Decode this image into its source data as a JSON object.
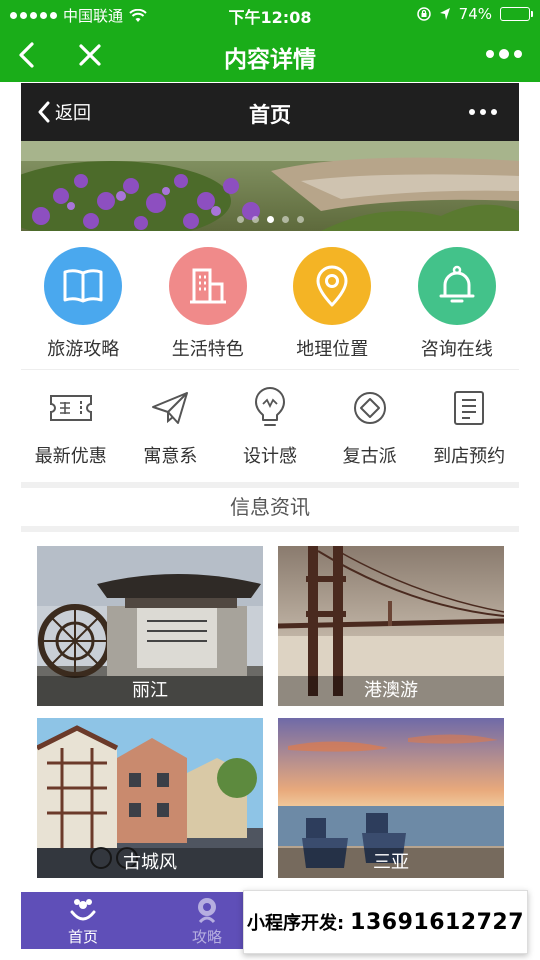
{
  "status_bar": {
    "carrier": "中国联通",
    "time": "下午12:08",
    "battery": "74%",
    "battery_level": 0.74
  },
  "wechat_nav": {
    "title": "内容详情",
    "icons": [
      "back-arrow-icon",
      "close-icon",
      "more-dots-icon"
    ]
  },
  "inner_nav": {
    "back_label": "返回",
    "title": "首页"
  },
  "banner": {
    "slide_count": 5,
    "active_slide": 3
  },
  "categories": [
    {
      "label": "旅游攻略",
      "icon": "book-icon",
      "color": "#4aa8ee"
    },
    {
      "label": "生活特色",
      "icon": "building-icon",
      "color": "#f08a8a"
    },
    {
      "label": "地理位置",
      "icon": "location-pin-icon",
      "color": "#f4b425"
    },
    {
      "label": "咨询在线",
      "icon": "bell-icon",
      "color": "#43c28a"
    }
  ],
  "features": [
    {
      "label": "最新优惠",
      "icon": "ticket-icon"
    },
    {
      "label": "寓意系",
      "icon": "paper-plane-icon"
    },
    {
      "label": "设计感",
      "icon": "lightbulb-icon"
    },
    {
      "label": "复古派",
      "icon": "diamond-icon"
    },
    {
      "label": "到店预约",
      "icon": "document-icon"
    }
  ],
  "info_section": {
    "title": "信息资讯",
    "items": [
      {
        "caption": "丽江"
      },
      {
        "caption": "港澳游"
      },
      {
        "caption": "古城风"
      },
      {
        "caption": "三亚"
      }
    ]
  },
  "tabbar": {
    "tabs": [
      {
        "label": "首页",
        "icon": "home-flower-icon",
        "active": true
      },
      {
        "label": "攻略",
        "icon": "guide-icon",
        "active": false
      }
    ]
  },
  "contact": {
    "label": "小程序开发:",
    "phone": "13691612727"
  },
  "colors": {
    "wechat_green": "#1aad19",
    "inner_nav_bg": "#1f1f1f",
    "tabbar_purple": "#5f4fb8"
  }
}
